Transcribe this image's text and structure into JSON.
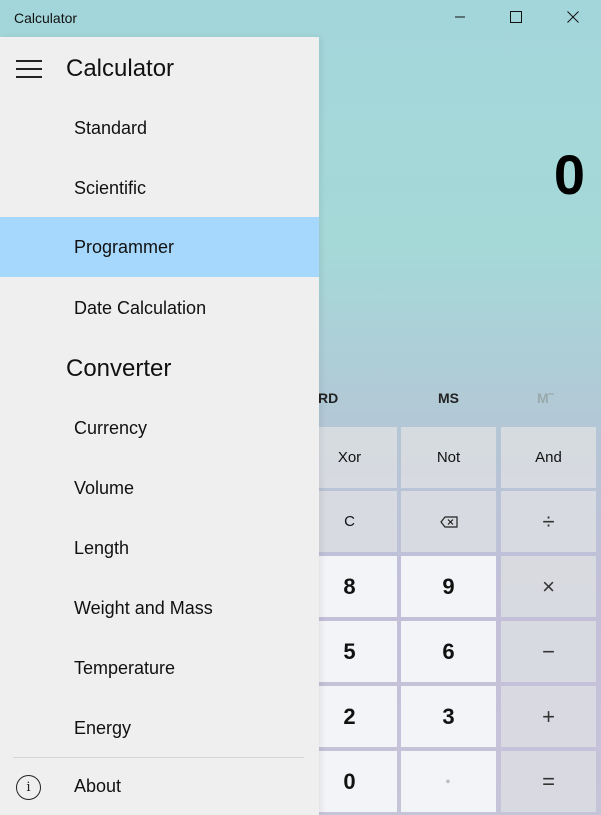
{
  "window": {
    "title": "Calculator",
    "icons": [
      "minimize-icon",
      "maximize-icon",
      "close-icon"
    ]
  },
  "display": {
    "value": "0"
  },
  "memory": {
    "partial": "RD",
    "ms": "MS",
    "m": "M˜"
  },
  "keypad": {
    "row1": [
      "Xor",
      "Not",
      "And"
    ],
    "row2": [
      "C",
      "⌫",
      "÷"
    ],
    "row3": [
      "8",
      "9",
      "×"
    ],
    "row4": [
      "5",
      "6",
      "−"
    ],
    "row5": [
      "2",
      "3",
      "+"
    ],
    "row6": [
      "0",
      "·",
      "="
    ]
  },
  "nav": {
    "title": "Calculator",
    "calculator_items": [
      "Standard",
      "Scientific",
      "Programmer",
      "Date Calculation"
    ],
    "selected": "Programmer",
    "converter_title": "Converter",
    "converter_items": [
      "Currency",
      "Volume",
      "Length",
      "Weight and Mass",
      "Temperature",
      "Energy"
    ],
    "about": "About"
  },
  "colors": {
    "nav_bg": "#efefef",
    "selected_bg": "#a6d8fd",
    "accent": "#0078d7"
  }
}
